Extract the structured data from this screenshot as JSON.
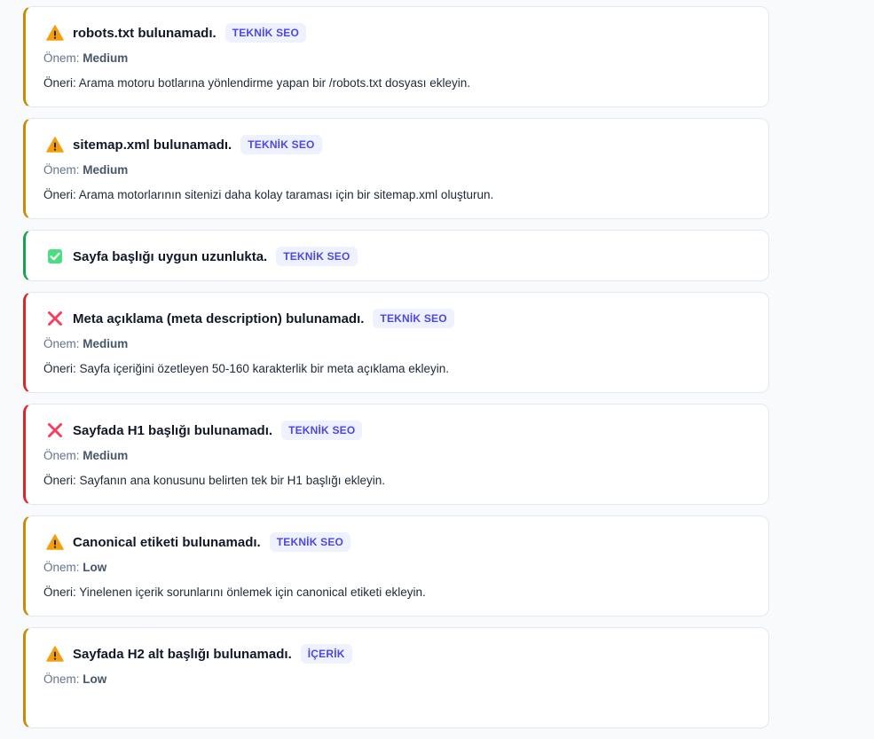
{
  "severity_label": "Önem:",
  "recommendation_label": "Öneri:",
  "issues": [
    {
      "status": "warning",
      "icon": "warning-icon",
      "title": "robots.txt bulunamadı.",
      "category": "TEKNİK SEO",
      "severity": "Medium",
      "recommendation": "Arama motoru botlarına yönlendirme yapan bir /robots.txt dosyası ekleyin."
    },
    {
      "status": "warning",
      "icon": "warning-icon",
      "title": "sitemap.xml bulunamadı.",
      "category": "TEKNİK SEO",
      "severity": "Medium",
      "recommendation": "Arama motorlarının sitenizi daha kolay taraması için bir sitemap.xml oluşturun."
    },
    {
      "status": "ok",
      "icon": "check-icon",
      "title": "Sayfa başlığı uygun uzunlukta.",
      "category": "TEKNİK SEO"
    },
    {
      "status": "error",
      "icon": "cross-icon",
      "title": "Meta açıklama (meta description) bulunamadı.",
      "category": "TEKNİK SEO",
      "severity": "Medium",
      "recommendation": "Sayfa içeriğini özetleyen 50-160 karakterlik bir meta açıklama ekleyin."
    },
    {
      "status": "error",
      "icon": "cross-icon",
      "title": "Sayfada H1 başlığı bulunamadı.",
      "category": "TEKNİK SEO",
      "severity": "Medium",
      "recommendation": "Sayfanın ana konusunu belirten tek bir H1 başlığı ekleyin."
    },
    {
      "status": "warning",
      "icon": "warning-icon",
      "title": "Canonical etiketi bulunamadı.",
      "category": "TEKNİK SEO",
      "severity": "Low",
      "recommendation": "Yinelenen içerik sorunlarını önlemek için canonical etiketi ekleyin."
    },
    {
      "status": "warning",
      "icon": "warning-icon",
      "title": "Sayfada H2 alt başlığı bulunamadı.",
      "category": "İÇERİK",
      "severity": "Low"
    }
  ],
  "colors": {
    "warning": "#ca8a04",
    "ok": "#16a34a",
    "error": "#dc2626",
    "badge_bg": "#eef2ff",
    "badge_text": "#4f46e5"
  }
}
